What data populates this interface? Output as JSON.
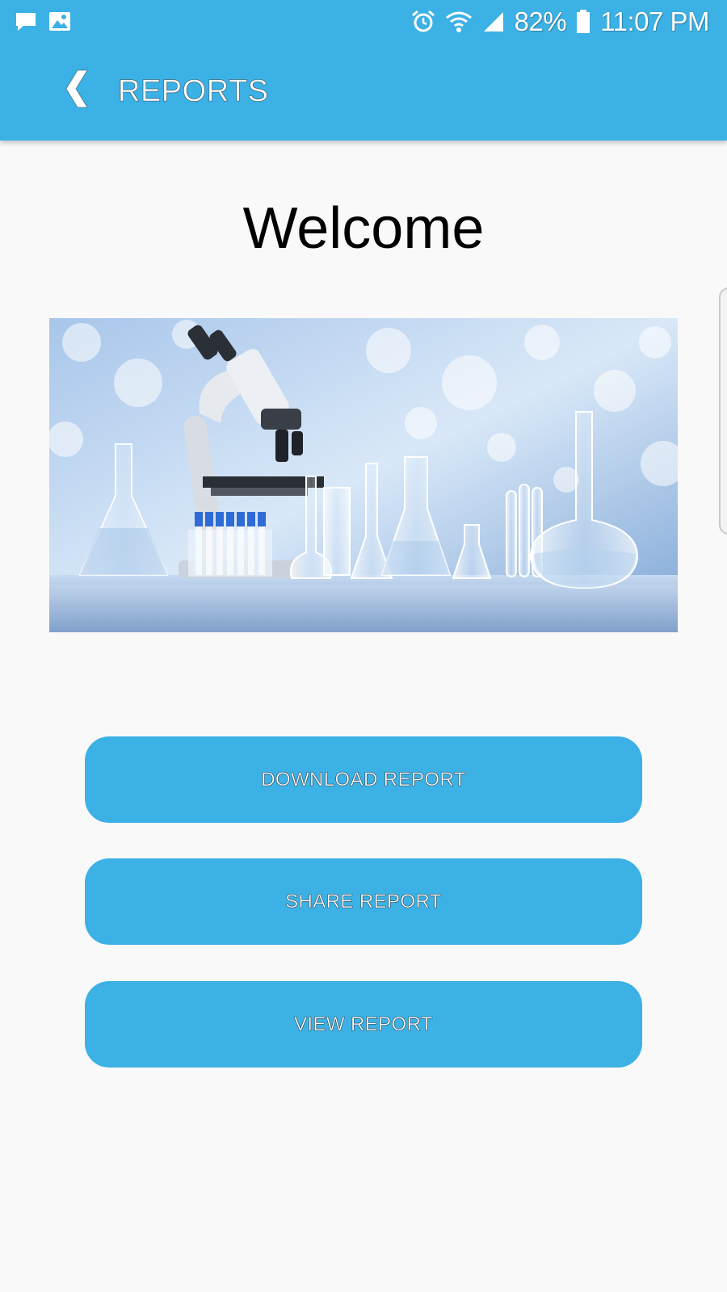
{
  "status_bar": {
    "icons_left": [
      "chat-bubble-icon",
      "image-icon"
    ],
    "icons_right": [
      "alarm-icon",
      "wifi-icon",
      "signal-icon",
      "battery-icon"
    ],
    "battery_percent": "82%",
    "time": "11:07 PM"
  },
  "toolbar": {
    "back_icon": "chevron-left-icon",
    "title": "REPORTS"
  },
  "main": {
    "heading": "Welcome",
    "hero_image": "laboratory-glassware-microscope-image"
  },
  "actions": {
    "download_label": "DOWNLOAD REPORT",
    "share_label": "SHARE REPORT",
    "view_label": "VIEW REPORT"
  },
  "colors": {
    "primary": "#3cb1e5",
    "background": "#f9f9fa",
    "text": "#000000",
    "on_primary": "#ffffff"
  }
}
